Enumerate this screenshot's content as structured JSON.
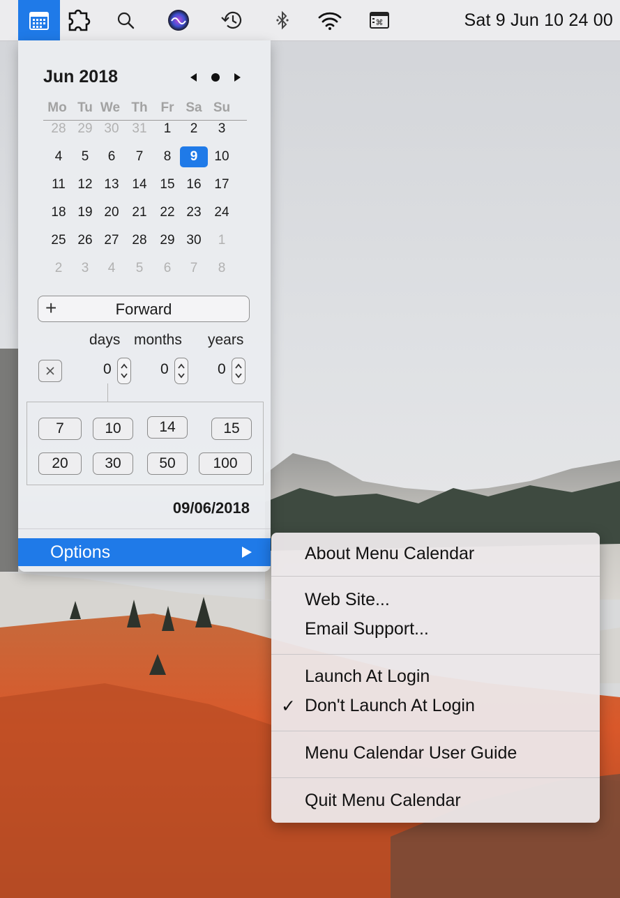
{
  "menubar": {
    "icons": [
      "calendar-icon",
      "puzzle-icon",
      "search-icon",
      "siri-icon",
      "time-machine-icon",
      "bluetooth-icon",
      "wifi-icon",
      "keyboard-viewer-icon"
    ],
    "clock": "Sat 9 Jun  10 24 00"
  },
  "calendar": {
    "month_title": "Jun 2018",
    "weekdays": [
      "Mo",
      "Tu",
      "We",
      "Th",
      "Fr",
      "Sa",
      "Su"
    ],
    "weeks": [
      [
        "28",
        "29",
        "30",
        "31",
        "1",
        "2",
        "3"
      ],
      [
        "4",
        "5",
        "6",
        "7",
        "8",
        "9",
        "10"
      ],
      [
        "11",
        "12",
        "13",
        "14",
        "15",
        "16",
        "17"
      ],
      [
        "18",
        "19",
        "20",
        "21",
        "22",
        "23",
        "24"
      ],
      [
        "25",
        "26",
        "27",
        "28",
        "29",
        "30",
        "1"
      ],
      [
        "2",
        "3",
        "4",
        "5",
        "6",
        "7",
        "8"
      ]
    ],
    "today": "9",
    "accent_color": "#1f7ae8"
  },
  "calculator": {
    "forward_label": "Forward",
    "units": [
      "days",
      "months",
      "years"
    ],
    "values": [
      "0",
      "0",
      "0"
    ],
    "presets": [
      "7",
      "10",
      "14",
      "15",
      "20",
      "30",
      "50",
      "100"
    ],
    "result": "09/06/2018"
  },
  "options": {
    "label": "Options"
  },
  "submenu": {
    "about": "About Menu Calendar",
    "website": "Web Site...",
    "email": "Email Support...",
    "launch": "Launch At Login",
    "dont_launch": "Don't Launch At Login",
    "checkmark": "✓",
    "guide": "Menu Calendar User Guide",
    "quit": "Quit Menu Calendar"
  }
}
